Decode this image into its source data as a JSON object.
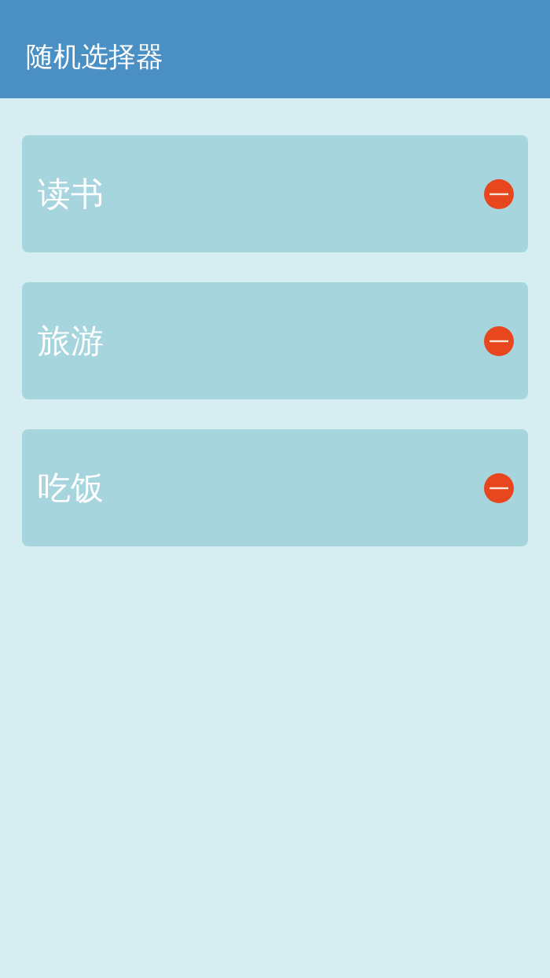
{
  "app_bar": {
    "title": "随机选择器"
  },
  "items": [
    {
      "label": "读书"
    },
    {
      "label": "旅游"
    },
    {
      "label": "吃饭"
    }
  ]
}
